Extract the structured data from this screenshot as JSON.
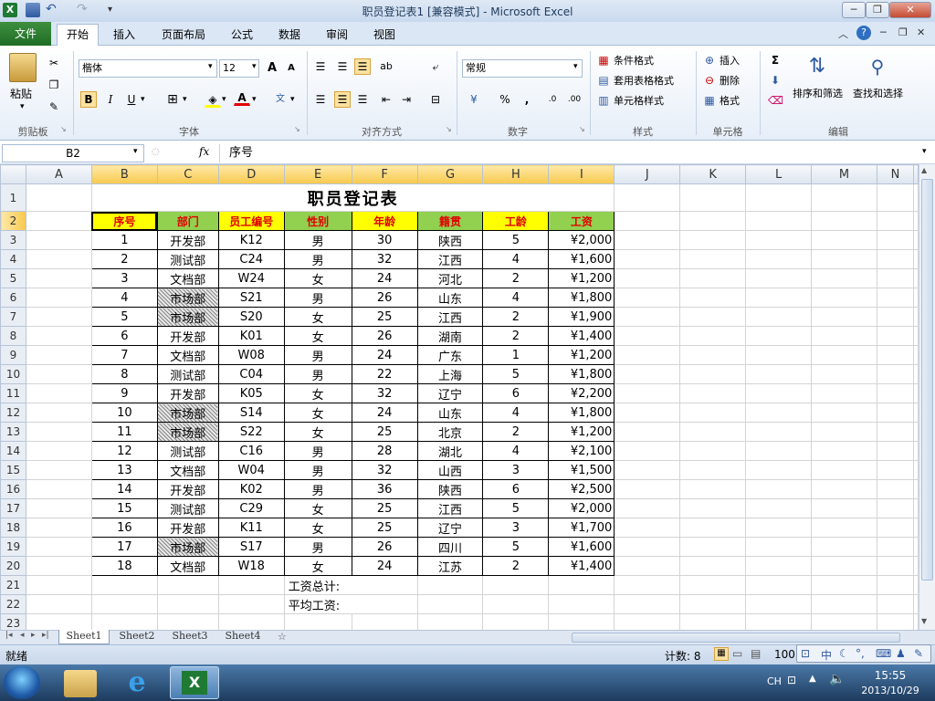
{
  "window": {
    "title": "职员登记表1  [兼容模式]  -  Microsoft Excel"
  },
  "ribbon_tabs": [
    "开始",
    "插入",
    "页面布局",
    "公式",
    "数据",
    "审阅",
    "视图"
  ],
  "file_tab": "文件",
  "clipboard": {
    "paste": "粘贴",
    "group": "剪贴板"
  },
  "font": {
    "name": "楷体",
    "size": "12",
    "group": "字体"
  },
  "alignment": {
    "group": "对齐方式"
  },
  "number": {
    "format": "常规",
    "group": "数字"
  },
  "styles": {
    "cond": "条件格式",
    "table": "套用表格格式",
    "cell": "单元格样式",
    "group": "样式"
  },
  "cells": {
    "insert": "插入",
    "delete": "删除",
    "format": "格式",
    "group": "单元格"
  },
  "editing": {
    "sort": "排序和筛选",
    "find": "查找和选择",
    "group": "编辑"
  },
  "formula_bar": {
    "name_box": "B2",
    "fx": "fx",
    "content": "序号"
  },
  "columns": [
    "A",
    "B",
    "C",
    "D",
    "E",
    "F",
    "G",
    "H",
    "I",
    "J",
    "K",
    "L",
    "M",
    "N"
  ],
  "sheet_title": "职员登记表",
  "headers": [
    "序号",
    "部门",
    "员工编号",
    "性别",
    "年龄",
    "籍贯",
    "工龄",
    "工资"
  ],
  "rows": [
    [
      "1",
      "开发部",
      "K12",
      "男",
      "30",
      "陕西",
      "5",
      "¥2,000"
    ],
    [
      "2",
      "测试部",
      "C24",
      "男",
      "32",
      "江西",
      "4",
      "¥1,600"
    ],
    [
      "3",
      "文档部",
      "W24",
      "女",
      "24",
      "河北",
      "2",
      "¥1,200"
    ],
    [
      "4",
      "市场部",
      "S21",
      "男",
      "26",
      "山东",
      "4",
      "¥1,800"
    ],
    [
      "5",
      "市场部",
      "S20",
      "女",
      "25",
      "江西",
      "2",
      "¥1,900"
    ],
    [
      "6",
      "开发部",
      "K01",
      "女",
      "26",
      "湖南",
      "2",
      "¥1,400"
    ],
    [
      "7",
      "文档部",
      "W08",
      "男",
      "24",
      "广东",
      "1",
      "¥1,200"
    ],
    [
      "8",
      "测试部",
      "C04",
      "男",
      "22",
      "上海",
      "5",
      "¥1,800"
    ],
    [
      "9",
      "开发部",
      "K05",
      "女",
      "32",
      "辽宁",
      "6",
      "¥2,200"
    ],
    [
      "10",
      "市场部",
      "S14",
      "女",
      "24",
      "山东",
      "4",
      "¥1,800"
    ],
    [
      "11",
      "市场部",
      "S22",
      "女",
      "25",
      "北京",
      "2",
      "¥1,200"
    ],
    [
      "12",
      "测试部",
      "C16",
      "男",
      "28",
      "湖北",
      "4",
      "¥2,100"
    ],
    [
      "13",
      "文档部",
      "W04",
      "男",
      "32",
      "山西",
      "3",
      "¥1,500"
    ],
    [
      "14",
      "开发部",
      "K02",
      "男",
      "36",
      "陕西",
      "6",
      "¥2,500"
    ],
    [
      "15",
      "测试部",
      "C29",
      "女",
      "25",
      "江西",
      "5",
      "¥2,000"
    ],
    [
      "16",
      "开发部",
      "K11",
      "女",
      "25",
      "辽宁",
      "3",
      "¥1,700"
    ],
    [
      "17",
      "市场部",
      "S17",
      "男",
      "26",
      "四川",
      "5",
      "¥1,600"
    ],
    [
      "18",
      "文档部",
      "W18",
      "女",
      "24",
      "江苏",
      "2",
      "¥1,400"
    ]
  ],
  "summary": {
    "total": "工资总计:",
    "avg": "平均工资:"
  },
  "sheets": [
    "Sheet1",
    "Sheet2",
    "Sheet3",
    "Sheet4"
  ],
  "status": {
    "ready": "就绪",
    "count": "计数: 8",
    "zoom": "100"
  },
  "ime": {
    "lang": "中"
  },
  "taskbar": {
    "lang": "CH",
    "time": "15:55",
    "date": "2013/10/29"
  }
}
